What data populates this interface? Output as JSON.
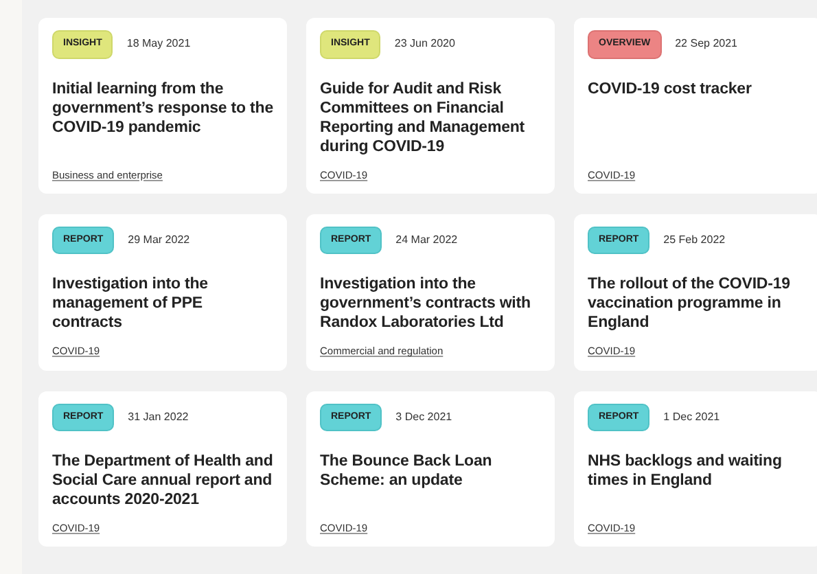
{
  "cards": [
    {
      "tag": "INSIGHT",
      "kind": "insight",
      "date": "18 May 2021",
      "title": "Initial learning from the government’s response to the COVID-19 pandemic",
      "topic": "Business and enterprise"
    },
    {
      "tag": "INSIGHT",
      "kind": "insight",
      "date": "23 Jun 2020",
      "title": "Guide for Audit and Risk Committees on Financial Reporting and Management during COVID-19",
      "topic": "COVID-19"
    },
    {
      "tag": "OVERVIEW",
      "kind": "overview",
      "date": "22 Sep 2021",
      "title": "COVID-19 cost tracker",
      "topic": "COVID-19"
    },
    {
      "tag": "REPORT",
      "kind": "report",
      "date": "29 Mar 2022",
      "title": "Investigation into the management of PPE contracts",
      "topic": "COVID-19"
    },
    {
      "tag": "REPORT",
      "kind": "report",
      "date": "24 Mar 2022",
      "title": "Investigation into the government’s contracts with Randox Laboratories Ltd",
      "topic": "Commercial and regulation"
    },
    {
      "tag": "REPORT",
      "kind": "report",
      "date": "25 Feb 2022",
      "title": "The rollout of the COVID-19 vaccination programme in England",
      "topic": "COVID-19"
    },
    {
      "tag": "REPORT",
      "kind": "report",
      "date": "31 Jan 2022",
      "title": "The Department of Health and Social Care annual report and accounts 2020-2021",
      "topic": "COVID-19"
    },
    {
      "tag": "REPORT",
      "kind": "report",
      "date": "3 Dec 2021",
      "title": "The Bounce Back Loan Scheme: an update",
      "topic": "COVID-19"
    },
    {
      "tag": "REPORT",
      "kind": "report",
      "date": "1 Dec 2021",
      "title": "NHS backlogs and waiting times in England",
      "topic": "COVID-19"
    }
  ]
}
